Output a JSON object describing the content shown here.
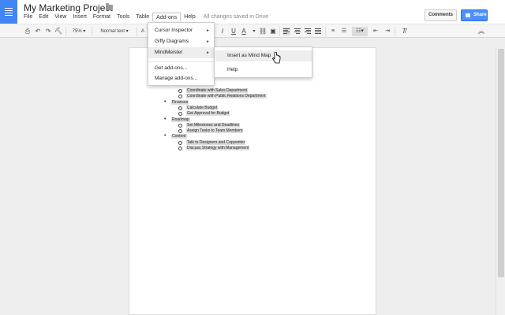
{
  "header": {
    "title": "My Marketing Project",
    "menus": [
      "File",
      "Edit",
      "View",
      "Insert",
      "Format",
      "Tools",
      "Table",
      "Add-ons",
      "Help"
    ],
    "active_menu": "Add-ons",
    "save_status": "All changes saved in Drive",
    "comments_label": "Comments",
    "share_label": "Share",
    "share_color": "#4d90fe"
  },
  "toolbar": {
    "zoom": "75%",
    "style": "Normal text",
    "font_partial": "A"
  },
  "addons_menu": {
    "items": [
      "Cursor Inspector",
      "Giffy Diagrams",
      "MindMeister",
      "Get add-ons...",
      "Manage add-ons..."
    ],
    "highlighted": "MindMeister"
  },
  "mindmeister_submenu": {
    "items": [
      "Insert as Mind Map",
      "Help"
    ],
    "highlighted": "Insert as Mind Map"
  },
  "document": {
    "list": [
      {
        "level": 2,
        "text": "Coordinate with Sales Department"
      },
      {
        "level": 2,
        "text": "Coordinate with Public Relations Department"
      },
      {
        "level": 1,
        "text": "Finances"
      },
      {
        "level": 2,
        "text": "Calculate Budget"
      },
      {
        "level": 2,
        "text": "Get Approval for Budget"
      },
      {
        "level": 1,
        "text": "Roadmap"
      },
      {
        "level": 2,
        "text": "Set Milestones and Deadlines"
      },
      {
        "level": 2,
        "text": "Assign Tasks to Team Members"
      },
      {
        "level": 1,
        "text": "Content"
      },
      {
        "level": 2,
        "text": "Talk to Designers and Copywriter"
      },
      {
        "level": 2,
        "text": "Discuss Strategy with Management"
      }
    ]
  }
}
